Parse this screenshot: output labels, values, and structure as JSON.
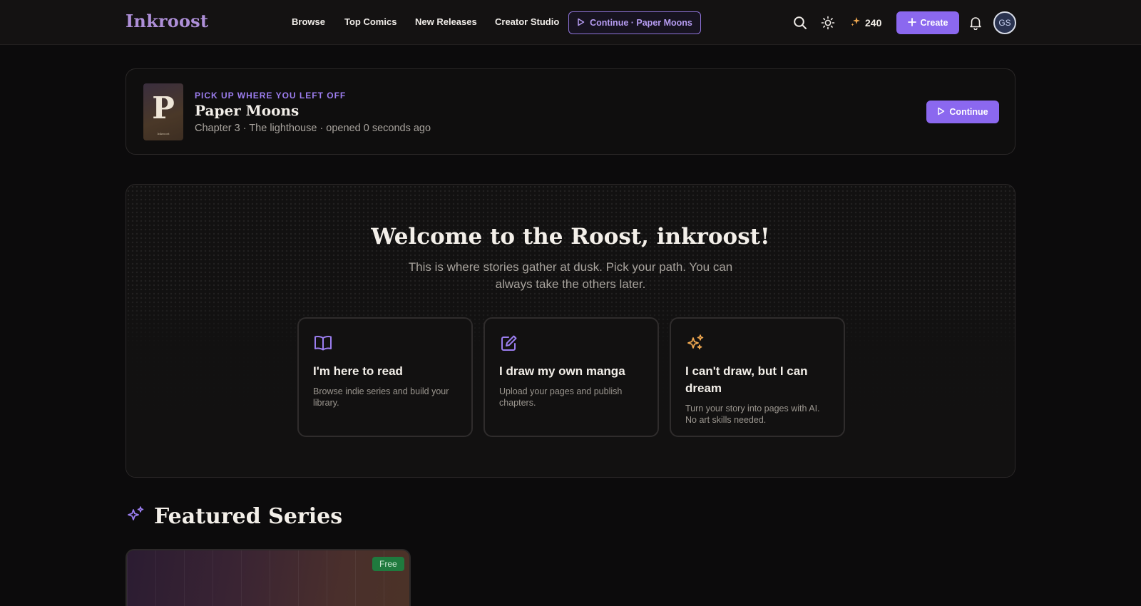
{
  "header": {
    "logo": "Inkroost",
    "nav": [
      "Browse",
      "Top Comics",
      "New Releases",
      "Creator Studio"
    ],
    "continue_pill": "Continue · Paper Moons",
    "credits": "240",
    "create_label": "Create",
    "avatar_initials": "GS"
  },
  "resume": {
    "cover_letter": "P",
    "cover_brand": "Inkroost",
    "eyebrow": "PICK UP WHERE YOU LEFT OFF",
    "title": "Paper Moons",
    "meta": "Chapter 3 · The lighthouse · opened 0 seconds ago",
    "button": "Continue"
  },
  "welcome": {
    "title": "Welcome to the Roost, inkroost!",
    "subtitle": "This is where stories gather at dusk. Pick your path. You can always take the others later.",
    "paths": [
      {
        "icon": "book-open-icon",
        "title": "I'm here to read",
        "desc": "Browse indie series and build your library."
      },
      {
        "icon": "pencil-square-icon",
        "title": "I draw my own manga",
        "desc": "Upload your pages and publish chapters."
      },
      {
        "icon": "sparkles-icon",
        "title": "I can't draw, but I can dream",
        "desc": "Turn your story into pages with AI. No art skills needed."
      }
    ]
  },
  "featured": {
    "title": "Featured Series",
    "badge": "Free"
  },
  "colors": {
    "accent": "#8b68ef",
    "logo": "#ae8fd8",
    "sparkle": "#f0a850",
    "background": "#0c0b0c",
    "free_badge": "#1f7a3e"
  }
}
